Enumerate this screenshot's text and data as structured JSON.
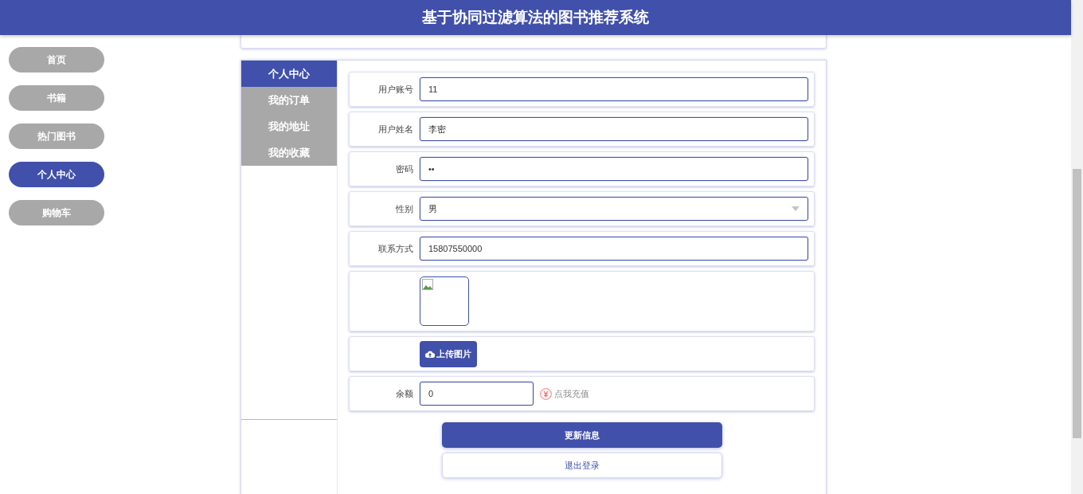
{
  "header": {
    "title": "基于协同过滤算法的图书推荐系统"
  },
  "sidebar": {
    "items": [
      {
        "label": "首页",
        "selected": false
      },
      {
        "label": "书籍",
        "selected": false
      },
      {
        "label": "热门图书",
        "selected": false
      },
      {
        "label": "个人中心",
        "selected": true
      },
      {
        "label": "购物车",
        "selected": false
      }
    ]
  },
  "tabs": [
    {
      "label": "个人中心",
      "selected": true
    },
    {
      "label": "我的订单",
      "selected": false
    },
    {
      "label": "我的地址",
      "selected": false
    },
    {
      "label": "我的收藏",
      "selected": false
    }
  ],
  "form": {
    "fields": [
      {
        "kind": "text",
        "label": "用户账号",
        "value": "11"
      },
      {
        "kind": "text",
        "label": "用户姓名",
        "value": "李密"
      },
      {
        "kind": "password",
        "label": "密码",
        "value": "••"
      },
      {
        "kind": "select",
        "label": "性别",
        "value": "男"
      },
      {
        "kind": "text",
        "label": "联系方式",
        "value": "15807550000"
      },
      {
        "kind": "image"
      },
      {
        "kind": "upload",
        "button": "上传图片"
      },
      {
        "kind": "balance",
        "label": "余额",
        "value": "0",
        "link": "点我充值"
      }
    ]
  },
  "buttons": {
    "update": "更新信息",
    "logout": "退出登录"
  }
}
